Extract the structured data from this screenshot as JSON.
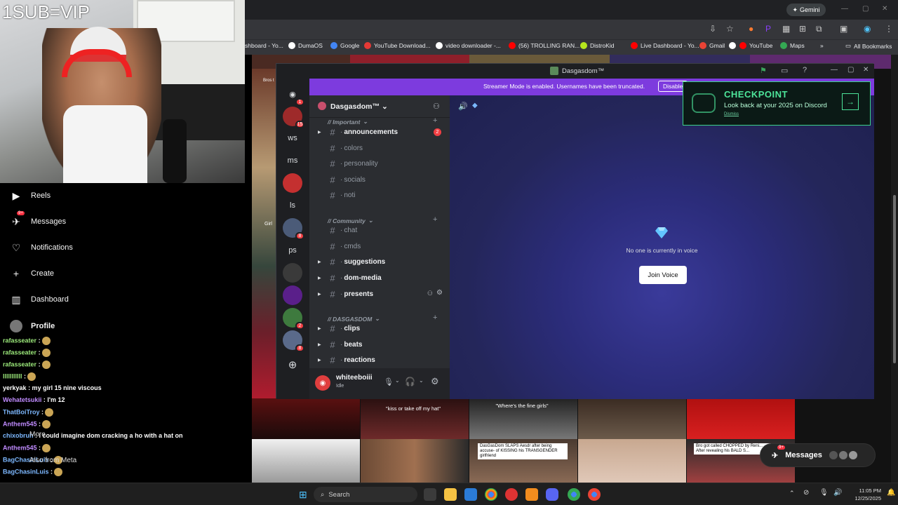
{
  "webcam": {
    "overlay_text": "1SUB=VIP"
  },
  "leftnav": {
    "items": [
      {
        "label": "Reels",
        "icon": "reels-icon"
      },
      {
        "label": "Messages",
        "icon": "messages-icon",
        "badge": "9+"
      },
      {
        "label": "Notifications",
        "icon": "heart-icon"
      },
      {
        "label": "Create",
        "icon": "plus-icon"
      },
      {
        "label": "Dashboard",
        "icon": "dashboard-icon"
      },
      {
        "label": "Profile",
        "icon": "avatar"
      }
    ]
  },
  "chat": {
    "lines": [
      {
        "name": "rafasseater",
        "text": ":",
        "color": "green"
      },
      {
        "name": "rafasseater",
        "text": ":",
        "color": "green"
      },
      {
        "name": "rafasseater",
        "text": ":",
        "color": "green"
      },
      {
        "name": "lllllllllll",
        "text": ":",
        "color": "green"
      },
      {
        "name": "yerkyak",
        "text": ": my girl 15 nine viscous",
        "color": "white"
      },
      {
        "name": "Wehatetsukii",
        "text": ": I'm 12",
        "color": "purple"
      },
      {
        "name": "ThatBoiTroy",
        "text": ":",
        "color": "blue"
      },
      {
        "name": "Anthem545",
        "text": ":",
        "color": "purple"
      },
      {
        "name": "chixobruh",
        "text": ": i could imagine dom cracking a ho with a hat on",
        "color": "blue"
      },
      {
        "name": "Anthem545",
        "text": ":",
        "color": "purple"
      },
      {
        "name": "BagChasinLuis",
        "text": ":",
        "color": "blue"
      },
      {
        "name": "BagChasinLuis",
        "text": ":",
        "color": "blue"
      },
      {
        "name": "chixobruh",
        "text": ": i could imagine dom cracking a ho with a hat on",
        "color": "blue"
      }
    ],
    "more_label": "More",
    "meta_label": "Also from Meta"
  },
  "browser": {
    "gemini_label": "Gemini",
    "bookmarks": [
      {
        "label": "shboard - Yo...",
        "color": "#888888"
      },
      {
        "label": "DumaOS",
        "color": "#ffffff"
      },
      {
        "label": "Google",
        "color": "#4285f4"
      },
      {
        "label": "YouTube Download...",
        "color": "#e53935"
      },
      {
        "label": "video downloader -...",
        "color": "#ffffff"
      },
      {
        "label": "(56) TROLLING RAN...",
        "color": "#ff0000"
      },
      {
        "label": "DistroKid",
        "color": "#b5e61d"
      },
      {
        "label": "Live Dashboard - Yo...",
        "color": "#ff0000"
      },
      {
        "label": "Gmail",
        "color": "#ea4335"
      },
      {
        "label": "",
        "color": "#ffffff"
      },
      {
        "label": "YouTube",
        "color": "#ff0000"
      },
      {
        "label": "Maps",
        "color": "#34a853"
      }
    ],
    "all_bookmarks": "All Bookmarks"
  },
  "page": {
    "captions": {
      "cap1": "\"kiss or take off my hat\"",
      "cap2": "\"Where's the fine girls\"",
      "box1": "DasGasDom SLAPS Aesdr after being accuse- of KISSING his TRANSGENDER girlfriend",
      "box2": "Bro got called CHOPPED by Reni... After revealing his BALD S...",
      "left1": "Bros t",
      "left2": "Girl"
    },
    "messages_pill": {
      "label": "Messages",
      "badge": "9+"
    }
  },
  "discord": {
    "window_title": "Dasgasdom™",
    "streamer_banner": "Streamer Mode is enabled. Usernames have been truncated.",
    "disable_label": "Disable",
    "server_name": "Dasgasdom™",
    "guilds": [
      {
        "label": "",
        "badge": "1",
        "kind": "home"
      },
      {
        "label": "",
        "badge": "15",
        "kind": "img"
      },
      {
        "label": "ws",
        "badge": ""
      },
      {
        "label": "ms",
        "badge": ""
      },
      {
        "label": "",
        "badge": "",
        "kind": "img"
      },
      {
        "label": "ls",
        "badge": ""
      },
      {
        "label": "",
        "badge": "8",
        "kind": "img"
      },
      {
        "label": "ps",
        "badge": ""
      },
      {
        "label": "",
        "badge": "",
        "kind": "img"
      },
      {
        "label": "",
        "badge": "",
        "kind": "img"
      },
      {
        "label": "",
        "badge": "2",
        "kind": "img"
      },
      {
        "label": "",
        "badge": "8",
        "kind": "img"
      }
    ],
    "categories": {
      "important": "// Important",
      "community": "// Community",
      "dasgasdom": "// DASGASDOM"
    },
    "channels": [
      {
        "label": "announcements",
        "unread": true,
        "mentions": "2"
      },
      {
        "label": "colors",
        "unread": false
      },
      {
        "label": "personality",
        "unread": false
      },
      {
        "label": "socials",
        "unread": false
      },
      {
        "label": "noti",
        "unread": false
      },
      {
        "label": "chat",
        "unread": false
      },
      {
        "label": "cmds",
        "unread": false
      },
      {
        "label": "suggestions",
        "unread": true
      },
      {
        "label": "dom-media",
        "unread": true
      },
      {
        "label": "presents",
        "unread": true
      },
      {
        "label": "clips",
        "unread": true
      },
      {
        "label": "beats",
        "unread": true
      },
      {
        "label": "reactions",
        "unread": true
      }
    ],
    "user": {
      "name": "whiteeboiii",
      "status": "Idle"
    },
    "voice": {
      "empty_text": "No one is currently in voice",
      "join_label": "Join Voice"
    }
  },
  "checkpoint": {
    "title": "CHECKPOINT",
    "subtitle": "Look back at your 2025 on Discord",
    "dismiss": "Dismiss"
  },
  "taskbar": {
    "search_label": "Search",
    "time": "11:05 PM",
    "date": "12/25/2025"
  }
}
